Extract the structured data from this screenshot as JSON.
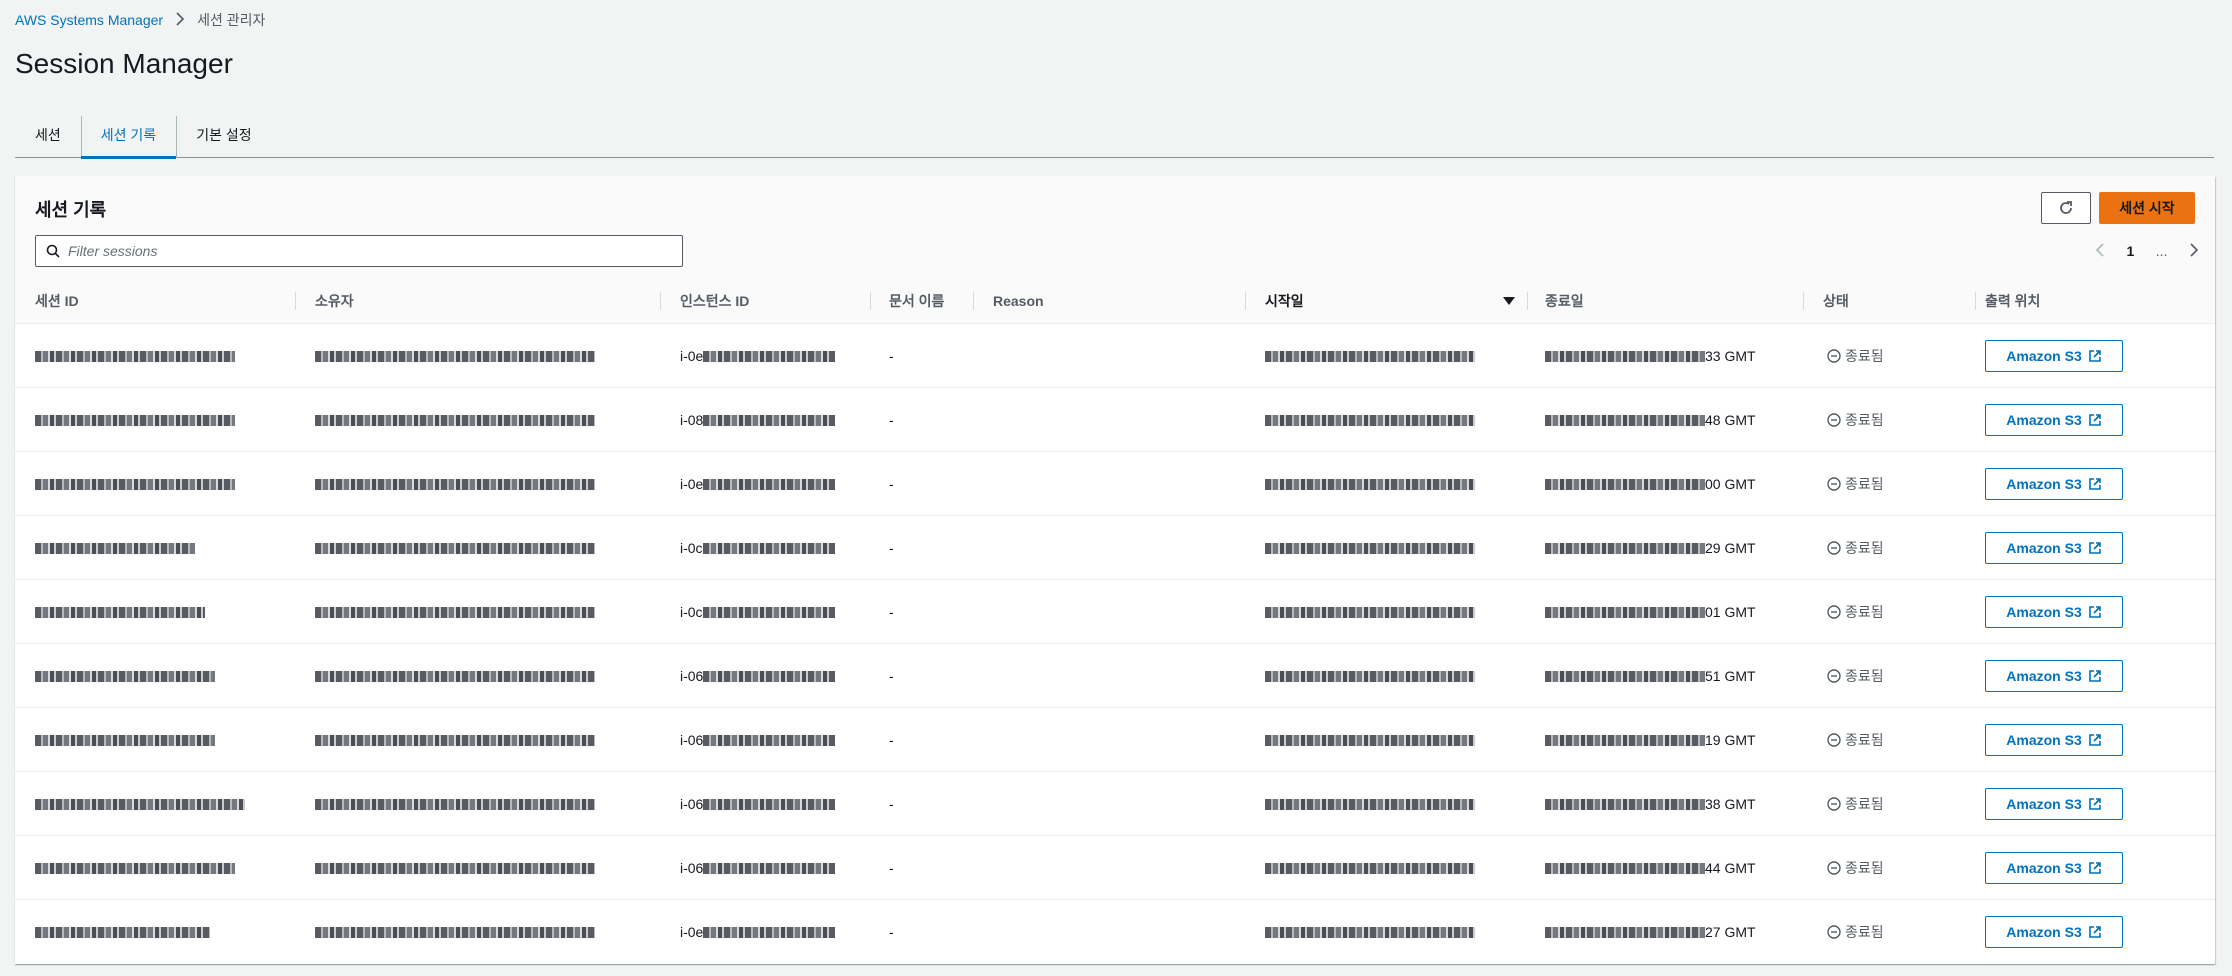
{
  "breadcrumb": {
    "root": "AWS Systems Manager",
    "current": "세션 관리자"
  },
  "page": {
    "title": "Session Manager"
  },
  "tabs": [
    {
      "label": "세션",
      "active": false
    },
    {
      "label": "세션 기록",
      "active": true
    },
    {
      "label": "기본 설정",
      "active": false
    }
  ],
  "panel": {
    "title": "세션 기록",
    "start_session_label": "세션 시작",
    "search_placeholder": "Filter sessions",
    "pagination": {
      "current_page": "1",
      "ellipsis": "..."
    }
  },
  "table": {
    "columns": [
      "세션 ID",
      "소유자",
      "인스턴스 ID",
      "문서 이름",
      "Reason",
      "시작일",
      "종료일",
      "상태",
      "출력 위치"
    ],
    "sorted_column": "시작일",
    "rows": [
      {
        "instance_prefix": "i-0e",
        "document": "-",
        "end_suffix": "33 GMT",
        "status": "종료됨",
        "output": "Amazon S3"
      },
      {
        "instance_prefix": "i-08",
        "document": "-",
        "end_suffix": "48 GMT",
        "status": "종료됨",
        "output": "Amazon S3"
      },
      {
        "instance_prefix": "i-0e",
        "document": "-",
        "end_suffix": "00 GMT",
        "status": "종료됨",
        "output": "Amazon S3"
      },
      {
        "instance_prefix": "i-0c",
        "document": "-",
        "end_suffix": "29 GMT",
        "status": "종료됨",
        "output": "Amazon S3"
      },
      {
        "instance_prefix": "i-0c",
        "document": "-",
        "end_suffix": "01 GMT",
        "status": "종료됨",
        "output": "Amazon S3"
      },
      {
        "instance_prefix": "i-06",
        "document": "-",
        "end_suffix": "51 GMT",
        "status": "종료됨",
        "output": "Amazon S3"
      },
      {
        "instance_prefix": "i-06",
        "document": "-",
        "end_suffix": "19 GMT",
        "status": "종료됨",
        "output": "Amazon S3"
      },
      {
        "instance_prefix": "i-06",
        "document": "-",
        "end_suffix": "38 GMT",
        "status": "종료됨",
        "output": "Amazon S3"
      },
      {
        "instance_prefix": "i-06",
        "document": "-",
        "end_suffix": "44 GMT",
        "status": "종료됨",
        "output": "Amazon S3"
      },
      {
        "instance_prefix": "i-0e",
        "document": "-",
        "end_suffix": "27 GMT",
        "status": "종료됨",
        "output": "Amazon S3"
      }
    ]
  },
  "icons": {
    "refresh": "refresh-icon",
    "search": "search-icon",
    "external_link": "external-link-icon",
    "status_stopped": "stopped-status-icon",
    "chevron_left": "chevron-left-icon",
    "chevron_right": "chevron-right-icon",
    "breadcrumb_separator": "chevron-right-icon"
  },
  "colors": {
    "link": "#0073bb",
    "primary_button": "#ec7211",
    "background": "#f2f3f3"
  }
}
